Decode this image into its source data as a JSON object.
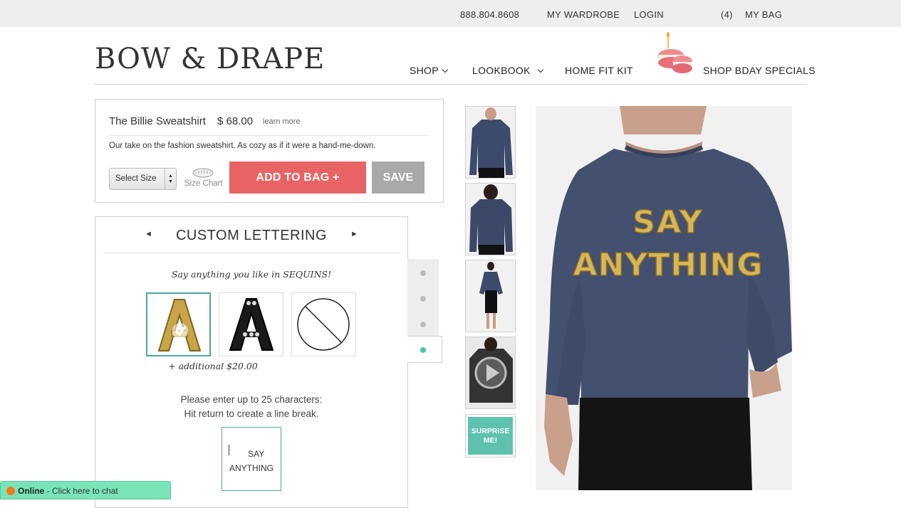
{
  "topbar": {
    "phone": "888.804.8608",
    "wardrobe": "MY WARDROBE",
    "login": "LOGIN",
    "bag_count": "(4)",
    "bag": "MY BAG"
  },
  "header": {
    "logo": "BOW & DRAPE",
    "nav": {
      "shop": "SHOP",
      "lookbook": "LOOKBOOK",
      "home_fit_kit": "HOME FIT KIT",
      "bday": "SHOP BDAY SPECIALS"
    }
  },
  "product": {
    "name": "The Billie Sweatshirt",
    "price": "$ 68.00",
    "learn_more": "learn more",
    "description": "Our take on the fashion sweatshirt. As cozy as if it were a hand-me-down.",
    "size_select": "Select Size",
    "size_chart": "Size Chart",
    "add_to_bag": "ADD TO BAG +",
    "save": "SAVE"
  },
  "lettering": {
    "title": "CUSTOM LETTERING",
    "prev": "◄",
    "next": "►",
    "subtitle": "Say anything you like in SEQUINS!",
    "options": [
      "gold-sequin-letter",
      "black-sequin-letter",
      "no-lettering"
    ],
    "selected": 0,
    "extra_cost": "+ additional $20.00",
    "instruction_line1": "Please enter up to 25 characters:",
    "instruction_line2": "Hit return to create a line break.",
    "text_value": "SAY\nANYTHING"
  },
  "steps": {
    "count": 4,
    "active": 3
  },
  "gallery": {
    "surprise": "SURPRISE ME!",
    "main_image_text": [
      "SAY",
      "ANYTHING"
    ]
  },
  "chat": {
    "status": "Online",
    "label": " - Click here to chat"
  },
  "colors": {
    "accent": "#4fc0ad",
    "add_button": "#e86464",
    "save_button": "#a9a9a9",
    "chat": "#79e4b8"
  }
}
